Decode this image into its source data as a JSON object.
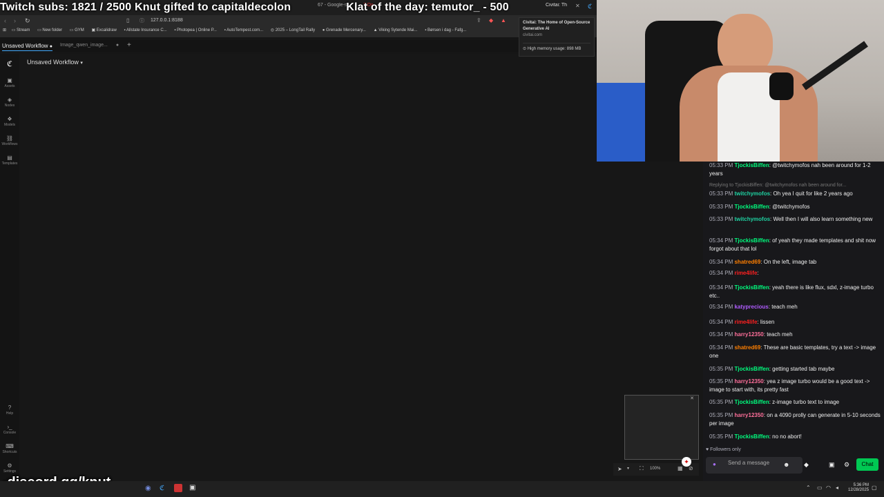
{
  "overlay": {
    "title": "Twitch subs: 1821 / 2500    Knut gifted to capitaldecolon",
    "klat": "Klat of the day: temutor_ - 500",
    "discord": "discord.gg/knut"
  },
  "browser": {
    "url": "127.0.0.1:8188",
    "bookmarks": [
      "Stream",
      "New folder",
      "GYM",
      "Excalidraw",
      "Allstate Insurance C...",
      "Photopea | Online P...",
      "AutoTempest.com...",
      "2025 – LongTail Rally",
      "Grenade Mercenary...",
      "Viking Sytende Mai...",
      "Børsen i dag - Fafg..."
    ],
    "tabs": [
      "67 - Google-s",
      "7 Da",
      "Civitai: Th"
    ],
    "popup": {
      "title": "Civitai: The Home of Open-Source Generative AI",
      "domain": "civitai.com",
      "memory": "High memory usage: 898 MB"
    }
  },
  "app": {
    "tabs": [
      {
        "label": "Unsaved Workflow"
      },
      {
        "label": "Image_qwen_image..."
      }
    ],
    "workflow_title": "Unsaved Workflow",
    "sidebar": [
      {
        "label": "Assets",
        "icon": "assets-icon"
      },
      {
        "label": "Nodes",
        "icon": "nodes-icon"
      },
      {
        "label": "Models",
        "icon": "models-icon"
      },
      {
        "label": "Workflows",
        "icon": "workflows-icon"
      },
      {
        "label": "Templates",
        "icon": "templates-icon"
      }
    ],
    "sidebar_bottom": [
      {
        "label": "Help"
      },
      {
        "label": "Console"
      },
      {
        "label": "Shortcuts"
      },
      {
        "label": "Settings"
      }
    ],
    "zoom": "100%"
  },
  "chat": {
    "messages": [
      {
        "time": "05:33 PM",
        "user": "TjockisBiffen",
        "color": "#00ff7f",
        "text": "@twitchymofos nah been around for 1-2 years"
      },
      {
        "reply": "Replying to TjockisBiffen: @twitchymofos nah been around for..."
      },
      {
        "time": "05:33 PM",
        "user": "twitchymofos",
        "color": "#1fd1a1",
        "text": "Oh yea I quit for like 2 years ago"
      },
      {
        "time": "05:33 PM",
        "user": "TjockisBiffen",
        "color": "#00ff7f",
        "text": "@twitchymofos"
      },
      {
        "time": "05:33 PM",
        "user": "twitchymofos",
        "color": "#1fd1a1",
        "text": "Well then I will also learn something new"
      },
      {
        "time": "05:34 PM",
        "user": "TjockisBiffen",
        "color": "#00ff7f",
        "text": "of yeah they made templates and shit now forgot about that lol"
      },
      {
        "time": "05:34 PM",
        "user": "shatred69",
        "color": "#ff7f00",
        "text": "On the left, image tab"
      },
      {
        "time": "05:34 PM",
        "user": "rime4life",
        "color": "#ff2020",
        "text": ""
      },
      {
        "time": "05:34 PM",
        "user": "TjockisBiffen",
        "color": "#00ff7f",
        "text": "yeah there is like flux, sdxl, z-image turbo etc.."
      },
      {
        "time": "05:34 PM",
        "user": "katyprecious",
        "color": "#b05cff",
        "text": "teach meh"
      },
      {
        "time": "05:34 PM",
        "user": "rime4life",
        "color": "#ff2020",
        "text": "lissen"
      },
      {
        "time": "05:34 PM",
        "user": "harry12350",
        "color": "#ff6f9a",
        "text": "teach meh"
      },
      {
        "time": "05:34 PM",
        "user": "shatred69",
        "color": "#ff7f00",
        "text": "These are basic templates, try a text -> image one"
      },
      {
        "time": "05:35 PM",
        "user": "TjockisBiffen",
        "color": "#00ff7f",
        "text": "getting started tab maybe"
      },
      {
        "time": "05:35 PM",
        "user": "harry12350",
        "color": "#ff6f9a",
        "text": "yea z image turbo would be a good text -> image to start with, its pretty fast"
      },
      {
        "time": "05:35 PM",
        "user": "TjockisBiffen",
        "color": "#00ff7f",
        "text": "z-image turbo text to image"
      },
      {
        "time": "05:35 PM",
        "user": "harry12350",
        "color": "#ff6f9a",
        "text": "on a 4090 prolly can generate in 5-10 seconds per image"
      },
      {
        "time": "05:35 PM",
        "user": "TjockisBiffen",
        "color": "#00ff7f",
        "text": "no no abort!"
      }
    ],
    "followers_only": "Followers only",
    "input_placeholder": "Send a message",
    "chat_button": "Chat"
  },
  "taskbar": {
    "time": "5:36 PM",
    "date": "12/28/2025"
  }
}
